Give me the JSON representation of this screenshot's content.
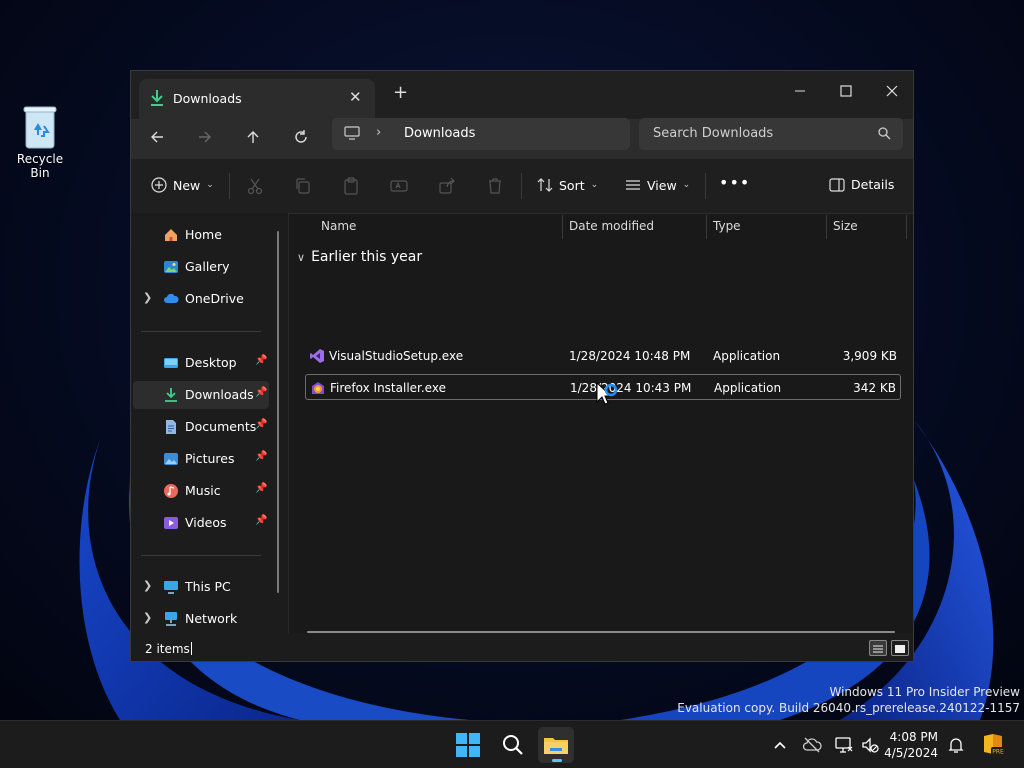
{
  "desktop": {
    "recycle_bin_label": "Recycle Bin",
    "watermark_line1": "Windows 11 Pro Insider Preview",
    "watermark_line2": "Evaluation copy. Build 26040.rs_prerelease.240122-1157"
  },
  "window": {
    "tab_title": "Downloads",
    "new_tab_label": "+",
    "address": {
      "current": "Downloads"
    },
    "search": {
      "placeholder": "Search Downloads"
    },
    "toolbar": {
      "new_label": "New",
      "sort_label": "Sort",
      "view_label": "View",
      "more_label": "•••",
      "details_label": "Details"
    },
    "nav": {
      "items": [
        {
          "label": "Home"
        },
        {
          "label": "Gallery"
        },
        {
          "label": "OneDrive"
        },
        {
          "label": "Desktop"
        },
        {
          "label": "Downloads"
        },
        {
          "label": "Documents"
        },
        {
          "label": "Pictures"
        },
        {
          "label": "Music"
        },
        {
          "label": "Videos"
        },
        {
          "label": "This PC"
        },
        {
          "label": "Network"
        }
      ]
    },
    "columns": {
      "name": "Name",
      "date": "Date modified",
      "type": "Type",
      "size": "Size"
    },
    "group_label": "Earlier this year",
    "files": [
      {
        "name": "VisualStudioSetup.exe",
        "date": "1/28/2024 10:48 PM",
        "type": "Application",
        "size": "3,909 KB"
      },
      {
        "name": "Firefox Installer.exe",
        "date": "1/28/2024 10:43 PM",
        "type": "Application",
        "size": "342 KB"
      }
    ],
    "status_text": "2 items"
  },
  "taskbar": {
    "time": "4:08 PM",
    "date": "4/5/2024"
  },
  "colors": {
    "accent": "#5ec3f3",
    "download_green": "#3ccf8e",
    "window_bg": "#191919"
  }
}
